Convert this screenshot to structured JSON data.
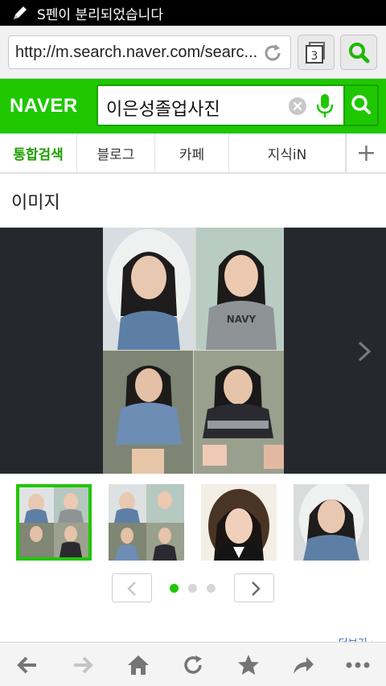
{
  "status_bar": {
    "notification": "S펜이 분리되었습니다"
  },
  "browser": {
    "url": "http://m.search.naver.com/searc...",
    "tab_count": "3"
  },
  "naver": {
    "logo": "NAVER",
    "query": "이은성졸업사진"
  },
  "category_tabs": [
    {
      "label": "통합검색",
      "active": true
    },
    {
      "label": "블로그",
      "active": false
    },
    {
      "label": "카페",
      "active": false
    },
    {
      "label": "지식iN",
      "active": false
    }
  ],
  "add_tab_label": "+",
  "section": {
    "title": "이미지"
  },
  "image_viewer": {
    "thumbnails": 4,
    "selected_thumbnail": 1,
    "page_dots": 3,
    "current_page": 1
  },
  "more_link": "더보기 ›",
  "colors": {
    "naver_green": "#1fc700",
    "viewer_bg": "#26282d",
    "link_blue": "#3b6fb5"
  },
  "icons": {
    "status": "pen-icon",
    "reload": "reload-icon",
    "tabs": "tabs-icon",
    "search": "search-icon",
    "clear": "clear-icon",
    "mic": "microphone-icon",
    "nav_back": "back-arrow-icon",
    "nav_forward": "forward-arrow-icon",
    "home": "home-icon",
    "refresh": "refresh-icon",
    "bookmark": "star-icon",
    "share": "share-icon",
    "menu": "more-dots-icon"
  }
}
